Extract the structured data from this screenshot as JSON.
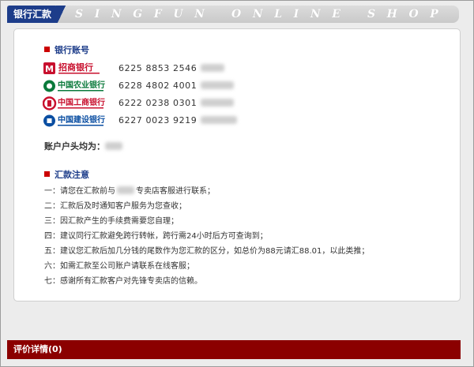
{
  "tab": {
    "label": "银行汇款"
  },
  "banner": {
    "text": "SINGFUN ONLINE SHOP LIST"
  },
  "accounts_section": {
    "title": "银行账号"
  },
  "banks": [
    {
      "name": "招商银行",
      "logo_color": "#c8102e",
      "account": "6225 8853 2546"
    },
    {
      "name": "中国农业银行",
      "logo_color": "#0a7a3b",
      "account": "6228 4802 4001"
    },
    {
      "name": "中国工商银行",
      "logo_color": "#c8102e",
      "account": "6222 0238 0301"
    },
    {
      "name": "中国建设银行",
      "logo_color": "#0a4ea2",
      "account": "6227 0023 9219"
    }
  ],
  "holder": {
    "label": "账户户头均为："
  },
  "notes_section": {
    "title": "汇款注意"
  },
  "notes": [
    "一：请您在汇款前与",
    "专卖店客服进行联系；",
    "二：汇款后及时通知客户服务为您查收；",
    "三：因汇款产生的手续费需要您自理；",
    "四：建议同行汇款避免跨行转帐，跨行需24小时后方可查询到；",
    "五：建议您汇款后加几分钱的尾数作为您汇款的区分，如总价为88元请汇88.01，以此类推；",
    "六：如需汇款至公司账户请联系在线客服；",
    "七：感谢所有汇款客户对先锋专卖店的信赖。"
  ],
  "footer": {
    "label": "评价详情(0)"
  },
  "colors": {
    "accent": "#1d3d8a",
    "footer_bg": "#8b0000",
    "bullet": "#cc0000"
  }
}
